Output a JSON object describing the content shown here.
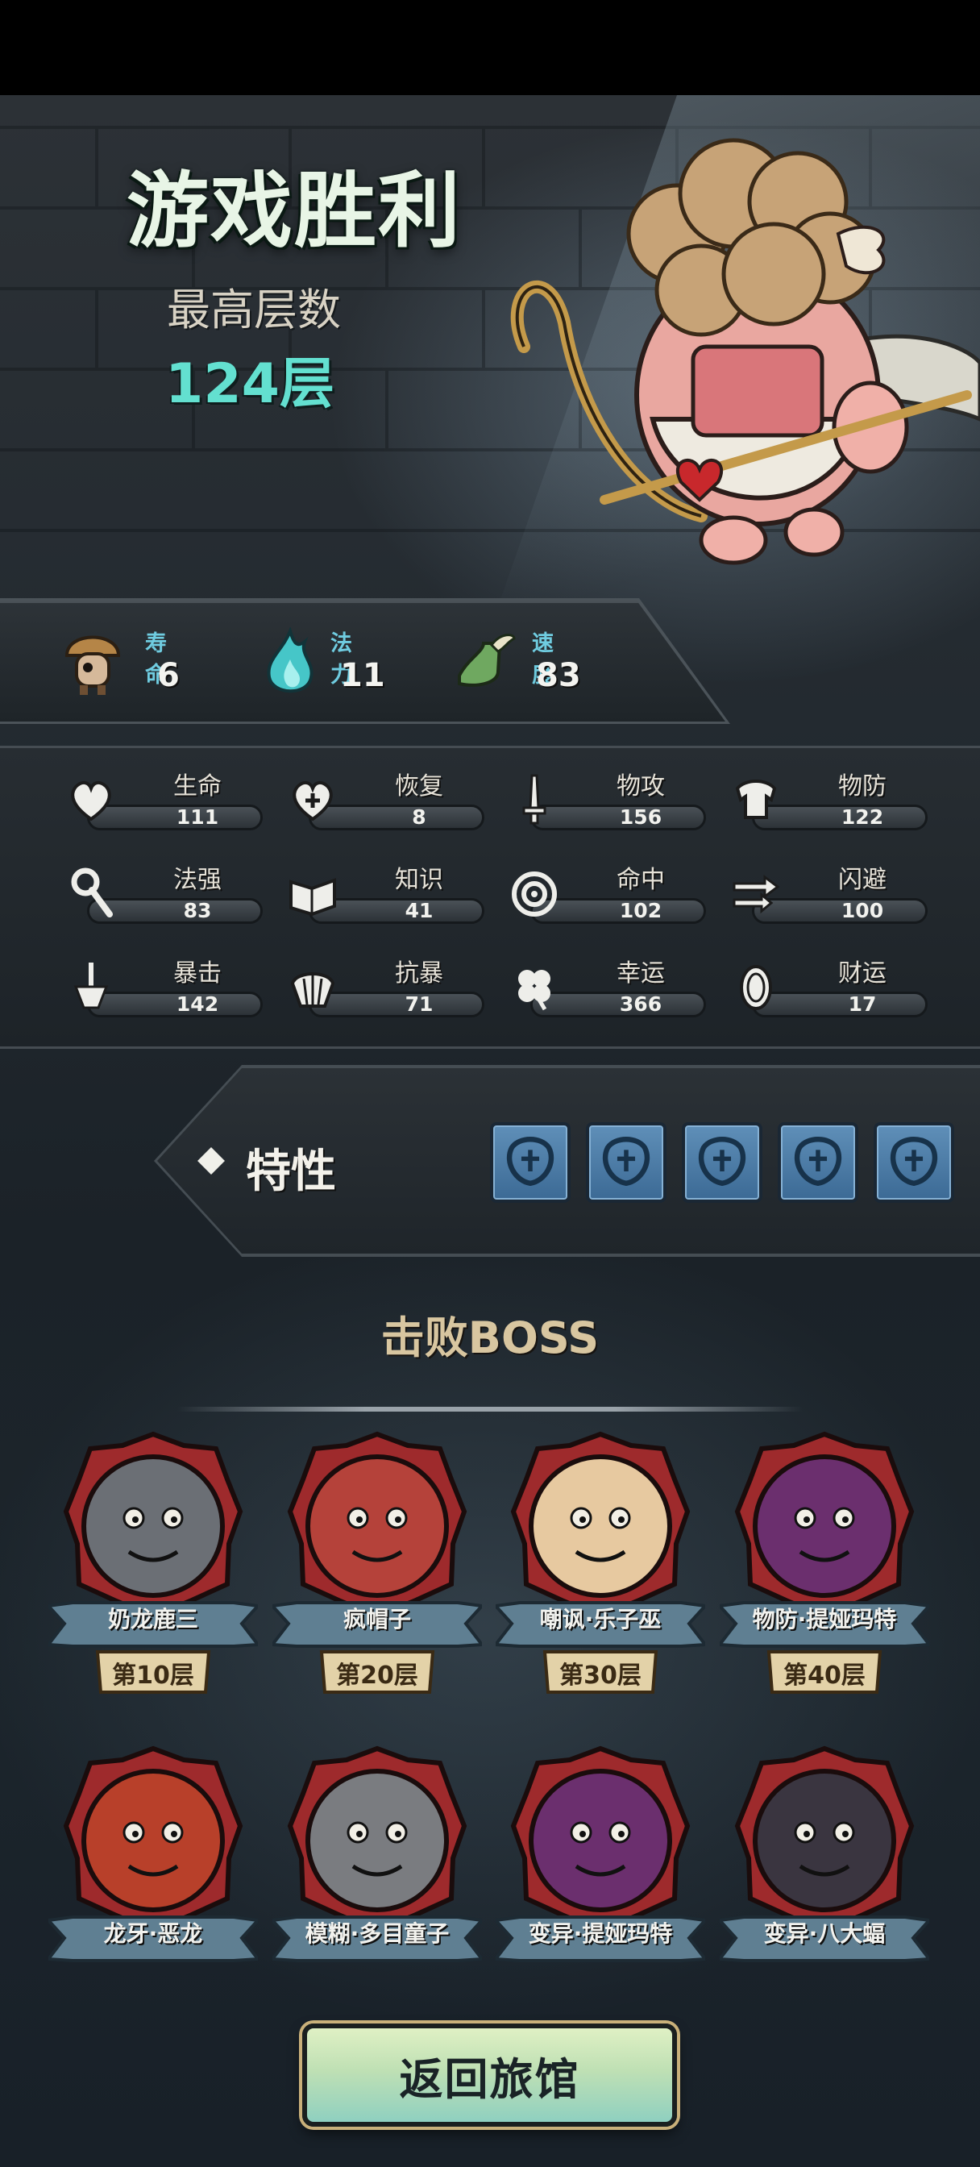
{
  "header": {
    "title": "游戏胜利",
    "floor_label": "最高层数",
    "floor_value": "124层"
  },
  "core_stats": [
    {
      "name": "寿命",
      "value": "6",
      "icon": "mushroom-creature-icon"
    },
    {
      "name": "法力",
      "value": "11",
      "icon": "blue-flame-icon"
    },
    {
      "name": "速度",
      "value": "83",
      "icon": "winged-boot-icon"
    }
  ],
  "attributes": [
    {
      "name": "生命",
      "value": "111",
      "icon": "heart-icon"
    },
    {
      "name": "恢复",
      "value": "8",
      "icon": "heart-plus-icon"
    },
    {
      "name": "物攻",
      "value": "156",
      "icon": "sword-icon"
    },
    {
      "name": "物防",
      "value": "122",
      "icon": "armor-icon"
    },
    {
      "name": "法强",
      "value": "83",
      "icon": "staff-icon"
    },
    {
      "name": "知识",
      "value": "41",
      "icon": "book-icon"
    },
    {
      "name": "命中",
      "value": "102",
      "icon": "target-icon"
    },
    {
      "name": "闪避",
      "value": "100",
      "icon": "dodge-arrows-icon"
    },
    {
      "name": "暴击",
      "value": "142",
      "icon": "crit-dagger-icon"
    },
    {
      "name": "抗暴",
      "value": "71",
      "icon": "shell-shield-icon"
    },
    {
      "name": "幸运",
      "value": "366",
      "icon": "clover-icon"
    },
    {
      "name": "财运",
      "value": "17",
      "icon": "coin-icon"
    }
  ],
  "traits": {
    "label": "特性",
    "slots": [
      "trait-fist-icon",
      "trait-broken-rune-icon",
      "trait-feet-icon",
      "trait-creature-icon",
      "trait-bird-icon"
    ]
  },
  "bosses": {
    "title": "击败BOSS",
    "items": [
      {
        "name": "奶龙鹿三",
        "floor": "第10层",
        "color": "#6b6f75"
      },
      {
        "name": "疯帽子",
        "floor": "第20层",
        "color": "#b5423a"
      },
      {
        "name": "嘲讽·乐子巫",
        "floor": "第30层",
        "color": "#e7c9a0"
      },
      {
        "name": "物防·提娅玛特",
        "floor": "第40层",
        "color": "#6b2f6e"
      },
      {
        "name": "龙牙·恶龙",
        "floor": "",
        "color": "#b8402a"
      },
      {
        "name": "模糊·多目童子",
        "floor": "",
        "color": "#7a7c80"
      },
      {
        "name": "变异·提娅玛特",
        "floor": "",
        "color": "#6b2f6e"
      },
      {
        "name": "变异·八大蝠",
        "floor": "",
        "color": "#3a3540"
      }
    ]
  },
  "footer": {
    "return_label": "返回旅馆"
  }
}
